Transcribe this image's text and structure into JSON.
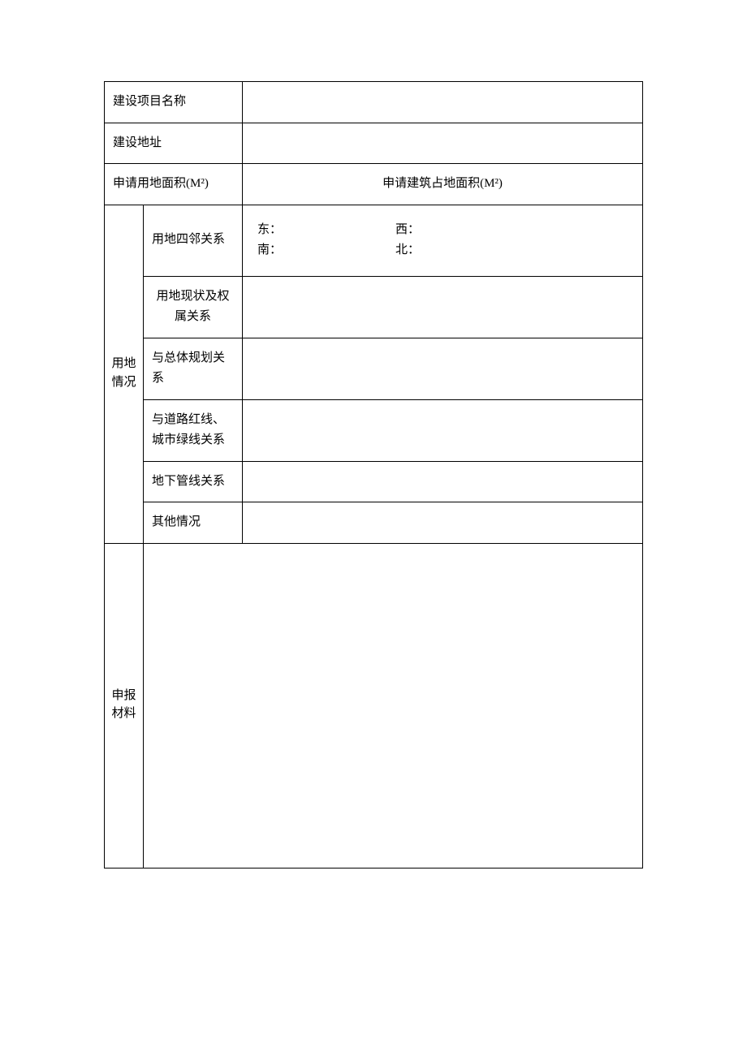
{
  "row1": {
    "label": "建设项目名称",
    "value": ""
  },
  "row2": {
    "label": "建设地址",
    "value": ""
  },
  "row3": {
    "leftLabel": "申请用地面积(M²)",
    "rightLabel": "申请建筑占地面积(M²)"
  },
  "landSection": {
    "header": "用地情况",
    "neighbors": {
      "label": "用地四邻关系",
      "east": "东：",
      "west": "西：",
      "south": "南：",
      "north": "北："
    },
    "status": {
      "label": "用地现状及权属关系",
      "value": ""
    },
    "overallPlan": {
      "label": "与总体规划关系",
      "value": ""
    },
    "roadGreen": {
      "label": "与道路红线、城市绿线关系",
      "value": ""
    },
    "underground": {
      "label": "地下管线关系",
      "value": ""
    },
    "other": {
      "label": "其他情况",
      "value": ""
    }
  },
  "materials": {
    "header": "申报材料",
    "value": ""
  }
}
